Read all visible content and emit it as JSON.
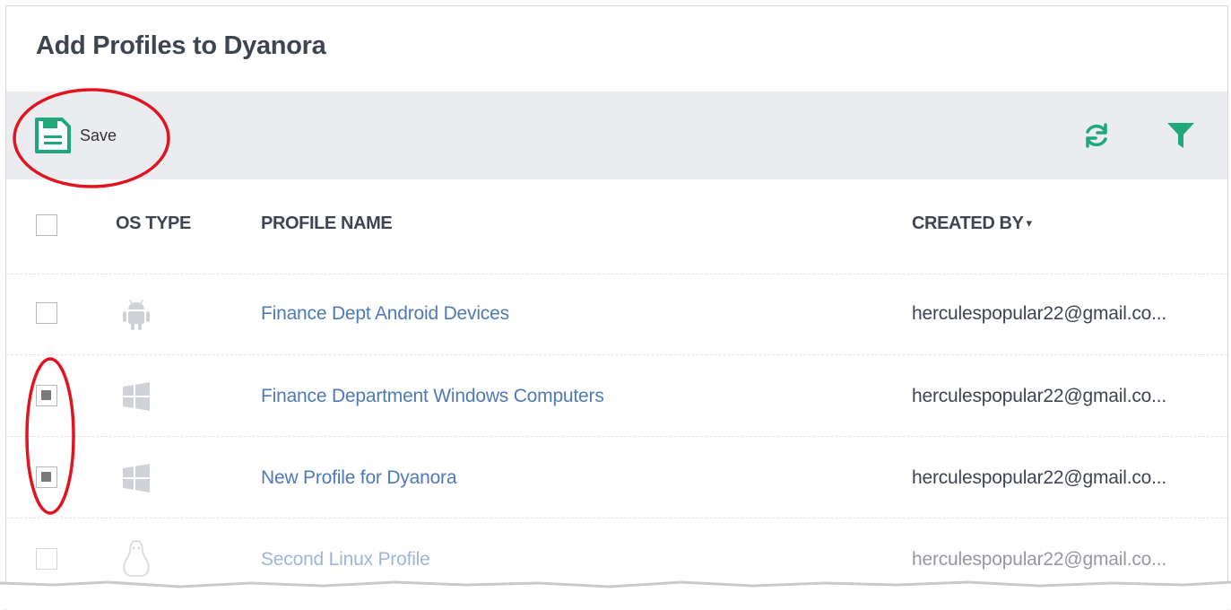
{
  "title": "Add Profiles to Dyanora",
  "toolbar": {
    "save_label": "Save",
    "save_icon": "floppy-disk-icon",
    "refresh_icon": "refresh-icon",
    "filter_icon": "filter-icon",
    "accent_color": "#1fa87a"
  },
  "table": {
    "columns": {
      "os_type": "OS TYPE",
      "profile_name": "PROFILE NAME",
      "created_by": "CREATED BY"
    },
    "sort_indicator": "▾",
    "rows": [
      {
        "os": "android-icon",
        "profile_name": "Finance Dept Android Devices",
        "created_by": "herculespopular22@gmail.co...",
        "checked": false
      },
      {
        "os": "windows-icon",
        "profile_name": "Finance Department Windows Computers",
        "created_by": "herculespopular22@gmail.co...",
        "checked": true
      },
      {
        "os": "windows-icon",
        "profile_name": "New Profile for Dyanora",
        "created_by": "herculespopular22@gmail.co...",
        "checked": true
      },
      {
        "os": "linux-icon",
        "profile_name": "Second Linux Profile",
        "created_by": "herculespopular22@gmail.co...",
        "checked": false
      }
    ]
  },
  "annotation_color": "#e0151f"
}
